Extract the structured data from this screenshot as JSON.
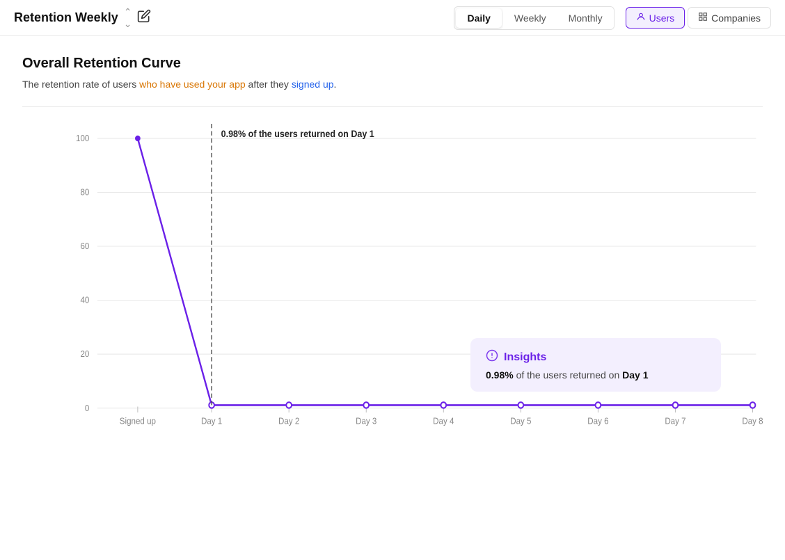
{
  "header": {
    "title": "Retention Weekly",
    "chevron": "⌄",
    "edit_icon": "✎",
    "period_buttons": [
      {
        "label": "Daily",
        "active": false
      },
      {
        "label": "Weekly",
        "active": true
      },
      {
        "label": "Monthly",
        "active": false
      }
    ],
    "segment_buttons": [
      {
        "label": "Users",
        "icon": "👤",
        "active": true
      },
      {
        "label": "Companies",
        "icon": "⊞",
        "active": false
      }
    ]
  },
  "main": {
    "section_title": "Overall Retention Curve",
    "section_desc_prefix": "The retention rate of users ",
    "section_desc_highlight1": "who have used your app",
    "section_desc_mid": " after they ",
    "section_desc_highlight2": "signed up",
    "section_desc_suffix": ".",
    "tooltip": {
      "label": "0.98% of the users returned on Day 1"
    },
    "x_axis": [
      "Signed up",
      "Day 1",
      "Day 2",
      "Day 3",
      "Day 4",
      "Day 5",
      "Day 6",
      "Day 7",
      "Day 8"
    ],
    "y_axis": [
      "100",
      "80",
      "60",
      "40",
      "20",
      "0"
    ],
    "insights": {
      "title": "Insights",
      "text_prefix": "0.98%",
      "text_mid": " of the users returned on ",
      "text_bold": "Day 1"
    }
  }
}
